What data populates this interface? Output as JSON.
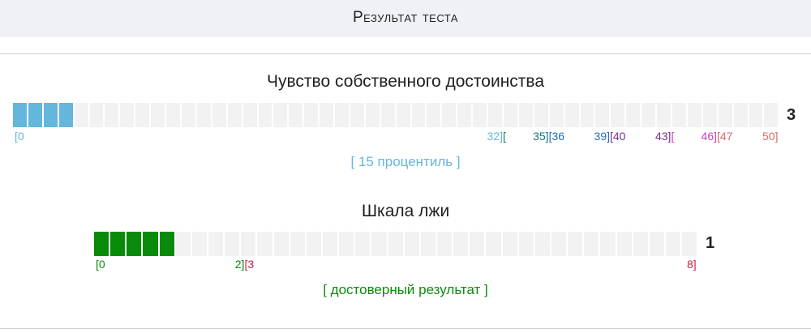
{
  "header": {
    "title": "Результат теста"
  },
  "scales": [
    {
      "title": "Чувство собственного достоинства",
      "score": "3",
      "max": 50,
      "filled": 3,
      "fill_color": "#64b6dc",
      "result": "[ 15 процентиль ]",
      "result_color": "#64b6dc",
      "ticks": [
        {
          "parts": [
            {
              "text": "[0",
              "color": "#64b6dc"
            }
          ],
          "pos": 0
        },
        {
          "parts": [
            {
              "text": "32]",
              "color": "#64b6dc"
            },
            {
              "text": "[",
              "color": "#0a7a7a"
            }
          ],
          "pos": 32
        },
        {
          "parts": [
            {
              "text": "35]",
              "color": "#0a7a7a"
            },
            {
              "text": "[36",
              "color": "#1f6fb0"
            }
          ],
          "pos": 35
        },
        {
          "parts": [
            {
              "text": "39]",
              "color": "#1f6fb0"
            },
            {
              "text": "[40",
              "color": "#7b2d8e"
            }
          ],
          "pos": 39
        },
        {
          "parts": [
            {
              "text": "43]",
              "color": "#7b2d8e"
            },
            {
              "text": "[",
              "color": "#c63fc6"
            }
          ],
          "pos": 43
        },
        {
          "parts": [
            {
              "text": "46]",
              "color": "#c63fc6"
            },
            {
              "text": "[47",
              "color": "#d86a6a"
            }
          ],
          "pos": 46
        },
        {
          "parts": [
            {
              "text": "50]",
              "color": "#d86a6a"
            }
          ],
          "pos": 50
        }
      ]
    },
    {
      "title": "Шкала лжи",
      "score": "1",
      "max": 8,
      "filled": 1,
      "fill_color": "#0a8a0a",
      "result": "[ достоверный результат ]",
      "result_color": "#0a8a0a",
      "ticks": [
        {
          "parts": [
            {
              "text": "[0",
              "color": "#0a8a0a"
            }
          ],
          "pos": 0
        },
        {
          "parts": [
            {
              "text": "2]",
              "color": "#0a8a0a"
            },
            {
              "text": "[3",
              "color": "#cc2244"
            }
          ],
          "pos": 2
        },
        {
          "parts": [
            {
              "text": "8]",
              "color": "#cc2244"
            }
          ],
          "pos": 8
        }
      ]
    }
  ]
}
